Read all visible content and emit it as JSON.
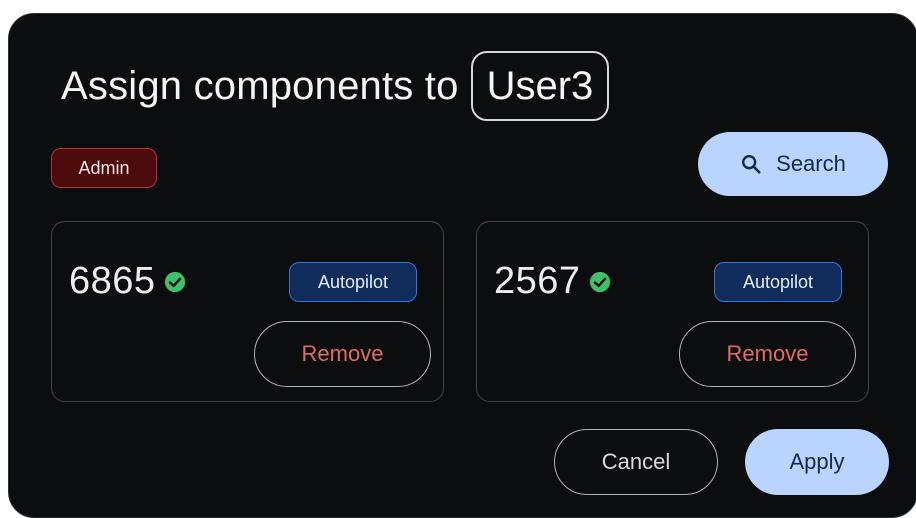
{
  "dialog": {
    "title_prefix": "Assign components to",
    "user": "User3",
    "role_badge": "Admin",
    "search_label": "Search",
    "search_icon": "search-icon"
  },
  "components": [
    {
      "id": "6865",
      "status_icon": "check-circle-icon",
      "mode": "Autopilot",
      "remove_label": "Remove"
    },
    {
      "id": "2567",
      "status_icon": "check-circle-icon",
      "mode": "Autopilot",
      "remove_label": "Remove"
    }
  ],
  "actions": {
    "cancel_label": "Cancel",
    "apply_label": "Apply"
  },
  "colors": {
    "background": "#0b0d0f",
    "primary_button": "#b9d4ff",
    "admin_badge": "#4d0b0b",
    "autopilot_badge": "#0f2c5a",
    "remove_text": "#e06a66",
    "status_ok": "#3fc169"
  }
}
